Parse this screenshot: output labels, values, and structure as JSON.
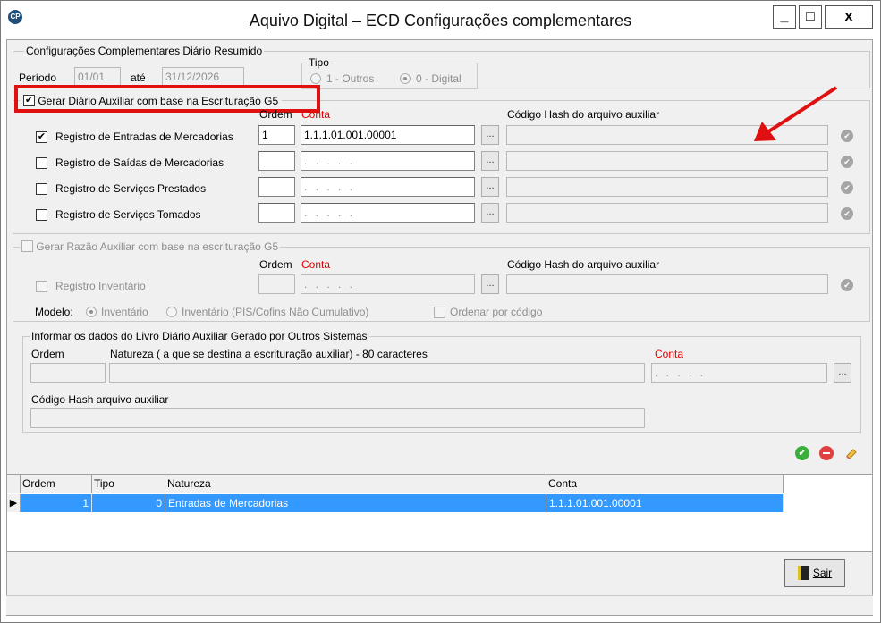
{
  "window": {
    "title": "Aquivo Digital – ECD Configurações complementares",
    "app_icon": "CP",
    "controls": {
      "minimize": "_",
      "maximize": "□",
      "close": "x"
    }
  },
  "section_diario": {
    "legend": "Configurações Complementares Diário Resumido",
    "periodo_label": "Período",
    "periodo_inicio": "01/01",
    "ate_label": "até",
    "periodo_fim": "31/12/2026",
    "tipo_legend": "Tipo",
    "tipo_options": [
      "1 - Outros",
      "0 - Digital"
    ],
    "tipo_selected": "0 - Digital"
  },
  "section_g5": {
    "checkbox_label": "Gerar Diário Auxiliar com base  na Escrituração G5",
    "checked": true,
    "col_ordem": "Ordem",
    "col_conta": "Conta",
    "col_hash": "Código Hash do arquivo auxiliar",
    "rows": [
      {
        "label": "Registro de Entradas de Mercadorias",
        "checked": true,
        "ordem": "1",
        "conta": "1.1.1.01.001.00001"
      },
      {
        "label": "Registro de Saídas de Mercadorias",
        "checked": false,
        "ordem": "",
        "conta": ". . . . ."
      },
      {
        "label": "Registro de Serviços Prestados",
        "checked": false,
        "ordem": "",
        "conta": ". . . . ."
      },
      {
        "label": "Registro de Serviços Tomados",
        "checked": false,
        "ordem": "",
        "conta": ". . . . ."
      }
    ],
    "browse_label": "..."
  },
  "section_razao": {
    "checkbox_label": "Gerar Razão Auxiliar com base na escrituração G5",
    "col_ordem": "Ordem",
    "col_conta": "Conta",
    "col_hash": "Código Hash do arquivo auxiliar",
    "row_label": "Registro Inventário",
    "conta": ". . . . .",
    "modelo_label": "Modelo:",
    "modelo_options": [
      "Inventário",
      "Inventário (PIS/Cofins Não Cumulativo)"
    ],
    "modelo_selected": "Inventário",
    "ordenar_label": "Ordenar por código"
  },
  "section_outros": {
    "legend": "Informar os dados do Livro Diário Auxiliar Gerado por Outros Sistemas",
    "ordem_label": "Ordem",
    "natureza_label": "Natureza ( a que se destina a escrituração auxiliar) - 80 caracteres",
    "conta_label": "Conta",
    "conta_value": ". . . . .",
    "hash_label": "Código Hash arquivo auxiliar"
  },
  "grid": {
    "columns": [
      "Ordem",
      "Tipo",
      "Natureza",
      "Conta"
    ],
    "rows": [
      {
        "ordem": "1",
        "tipo": "0",
        "natureza": "Entradas de Mercadorias",
        "conta": "1.1.1.01.001.00001"
      }
    ],
    "row_indicator": "▶"
  },
  "footer": {
    "sair_label": "Sair"
  },
  "colors": {
    "annotation_red": "#e01010",
    "selection_blue": "#3399ff",
    "required_red": "#e00000"
  }
}
